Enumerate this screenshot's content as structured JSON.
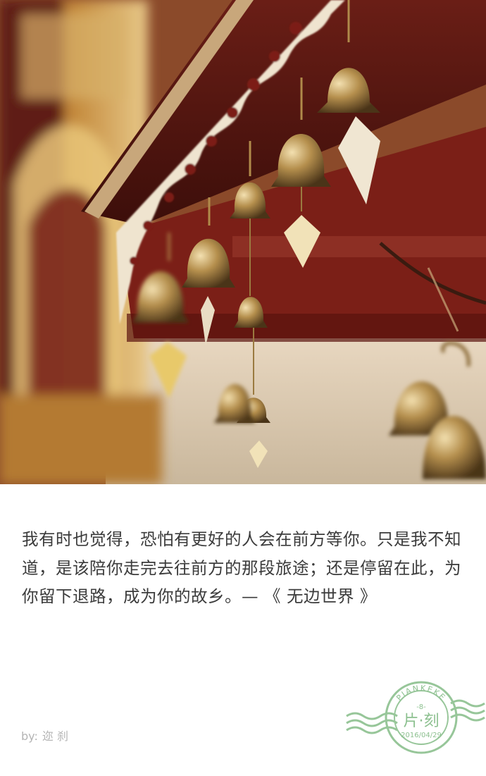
{
  "quote": {
    "text": "我有时也觉得，恐怕有更好的人会在前方等你。只是我不知道，是该陪你走完去往前方的那段旅途；还是停留在此，为你留下退路，成为你的故乡。— 《 无边世界 》"
  },
  "byline": {
    "label": "by:",
    "author": "迩 刹"
  },
  "stamp": {
    "brand_latin": "PIANKEKE",
    "brand_cn": "片·刻",
    "date": "2016/04/29",
    "color": "#8cc08f"
  }
}
